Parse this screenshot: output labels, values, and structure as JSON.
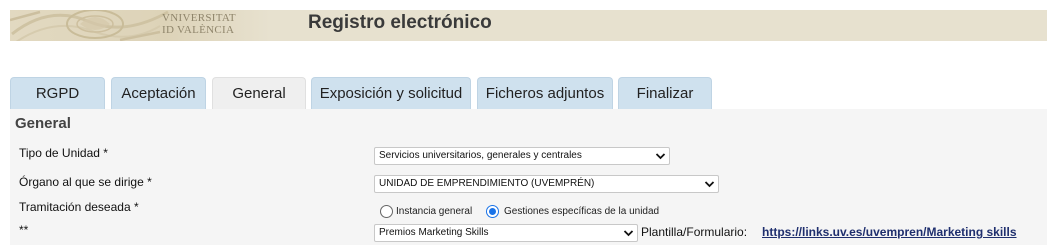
{
  "header": {
    "university_line1": "VNIVERSITAT",
    "university_line2": "ID VALÈNCIA",
    "app_title": "Registro electrónico"
  },
  "tabs": [
    {
      "label": "RGPD",
      "active": false
    },
    {
      "label": "Aceptación",
      "active": false
    },
    {
      "label": "General",
      "active": true
    },
    {
      "label": "Exposición y solicitud",
      "active": false
    },
    {
      "label": "Ficheros adjuntos",
      "active": false
    },
    {
      "label": "Finalizar",
      "active": false
    }
  ],
  "form": {
    "section_title": "General",
    "tipo_unidad": {
      "label": "Tipo de Unidad *",
      "selected": "Servicios universitarios, generales y centrales"
    },
    "organo": {
      "label": "Órgano al que se dirige *",
      "selected": "UNIDAD DE EMPRENDIMIENTO (UVEMPRÉN)"
    },
    "tramitacion": {
      "label": "Tramitación deseada *",
      "options": [
        {
          "label": "Instancia general",
          "checked": false
        },
        {
          "label": "Gestiones específicas de la unidad",
          "checked": true
        }
      ]
    },
    "gestion": {
      "label": "**",
      "selected": "Premios Marketing Skills",
      "plantilla_label": "Plantilla/Formulario:",
      "plantilla_link": "https://links.uv.es/uvempren/Marketing skills"
    }
  },
  "colors": {
    "header_bg": "#e7e1cf",
    "tab_bg": "#cfe1ee",
    "tab_active_bg": "#efefef",
    "content_bg": "#f5f5f5",
    "link": "#1f2f6e",
    "radio_accent": "#1a73e8"
  },
  "icons": {
    "seal": "university-seal-icon",
    "dropdown": "chevron-down-icon"
  }
}
